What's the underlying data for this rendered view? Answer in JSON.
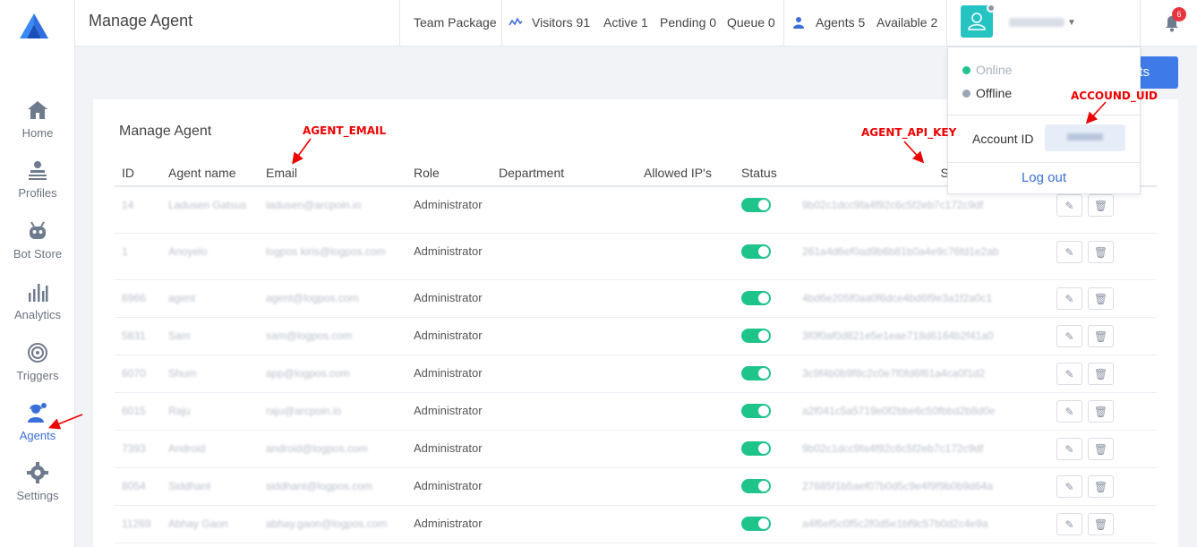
{
  "sidebar": {
    "items": [
      {
        "label": "Home",
        "icon": "home-icon"
      },
      {
        "label": "Profiles",
        "icon": "profiles-icon"
      },
      {
        "label": "Bot Store",
        "icon": "bot-icon"
      },
      {
        "label": "Analytics",
        "icon": "analytics-icon"
      },
      {
        "label": "Triggers",
        "icon": "triggers-icon"
      },
      {
        "label": "Agents",
        "icon": "agents-icon",
        "active": true
      },
      {
        "label": "Settings",
        "icon": "gear-icon"
      }
    ]
  },
  "header": {
    "title": "Manage Agent",
    "package": "Team Package",
    "visitors": "Visitors 91",
    "active": "Active 1",
    "pending": "Pending 0",
    "queue": "Queue 0",
    "agents": "Agents 5",
    "available": "Available 2",
    "notification_count": "6"
  },
  "blue_button_label": "nts",
  "card": {
    "title": "Manage Agent",
    "columns": [
      "ID",
      "Agent name",
      "Email",
      "Role",
      "Department",
      "Allowed IP's",
      "Status",
      "Secret Ke"
    ],
    "rows": [
      {
        "id": "14",
        "name": "Ladusen Gatsus",
        "email": "ladusen@arcpoin.io",
        "role": "Administrator",
        "key": "9b02c1dcc9fa4f92c6c5f2eb7c172c9df"
      },
      {
        "id": "1",
        "name": "Anoyelo",
        "email": "logpos kiris@logpos.com",
        "role": "Administrator",
        "key": "261a4d6ef0ad9b6b81b0a4e9c76fd1e2ab"
      },
      {
        "id": "6966",
        "name": "agent",
        "email": "agent@logpos.com",
        "role": "Administrator",
        "key": "4bd6e205f0aa0f6dce4bd6f9e3a1f2a0c1"
      },
      {
        "id": "5831",
        "name": "Sam",
        "email": "sam@logpos.com",
        "role": "Administrator",
        "key": "3f0f0af0d821e5e1eae718d6164b2f41a0"
      },
      {
        "id": "6070",
        "name": "Shum",
        "email": "app@logpos.com",
        "role": "Administrator",
        "key": "3c9f4b0b9f8c2c0e7f0fd6f61a4ca0f1d2"
      },
      {
        "id": "6015",
        "name": "Raju",
        "email": "raju@arcpoin.io",
        "role": "Administrator",
        "key": "a2f041c5a5719e0f2bbe6c50fbbd2b8d0e"
      },
      {
        "id": "7393",
        "name": "Android",
        "email": "android@logpos.com",
        "role": "Administrator",
        "key": "9b02c1dcc9fa4f92c6c5f2eb7c172c9df"
      },
      {
        "id": "8054",
        "name": "Siddhant",
        "email": "siddhant@logpos.com",
        "role": "Administrator",
        "key": "27685f1b5aef07b0d5c9e4f9f9b0b9d64a"
      },
      {
        "id": "11269",
        "name": "Abhay Gaon",
        "email": "abhay.gaon@logpos.com",
        "role": "Administrator",
        "key": "a4f6ef5c0f5c2f0d5e1bf9c57b0d2c4e9a"
      }
    ]
  },
  "dropdown": {
    "online": "Online",
    "offline": "Offline",
    "account_label": "Account ID",
    "logout": "Log out"
  },
  "annotations": {
    "agent_email": "AGENT_EMAIL",
    "agent_api_key": "AGENT_API_KEY",
    "account_uid": "ACCOUND_UID"
  },
  "colors": {
    "accent": "#3a6fd8",
    "toggle_on": "#1fc48a",
    "avatar": "#26c3c3",
    "badge": "#e8343f",
    "annotation": "#ee0000"
  }
}
